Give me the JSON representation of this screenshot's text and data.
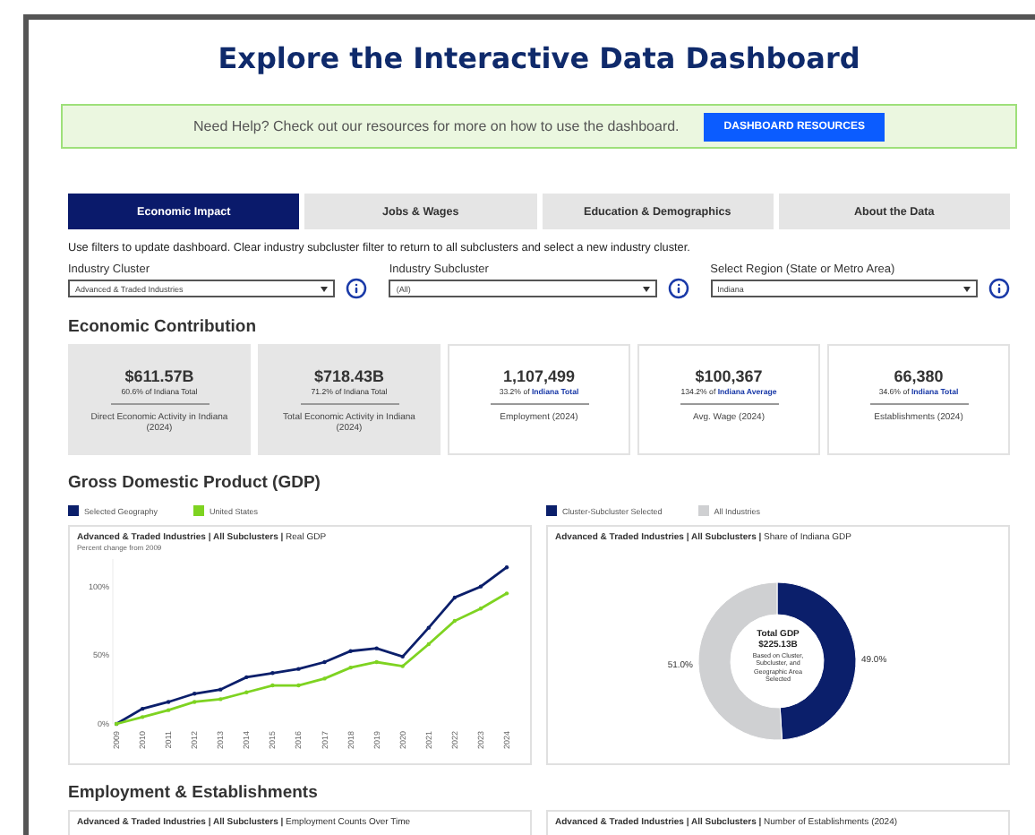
{
  "title": "Explore the Interactive Data Dashboard",
  "help_banner": {
    "text": "Need Help? Check out our resources for more on how to use the dashboard.",
    "button": "DASHBOARD RESOURCES"
  },
  "tabs": [
    {
      "label": "Economic Impact",
      "selected": true
    },
    {
      "label": "Jobs & Wages",
      "selected": false
    },
    {
      "label": "Education & Demographics",
      "selected": false
    },
    {
      "label": "About the Data",
      "selected": false
    }
  ],
  "instructions": "Use filters to update dashboard. Clear industry subcluster filter to return to all subclusters and select a new industry cluster.",
  "filters": [
    {
      "label": "Industry Cluster",
      "value": "Advanced & Traded Industries"
    },
    {
      "label": "Industry Subcluster",
      "value": "(All)"
    },
    {
      "label": "Select Region (State or Metro Area)",
      "value": "Indiana"
    }
  ],
  "economic_contribution": {
    "heading": "Economic Contribution",
    "cards": [
      {
        "value": "$611.57B",
        "note": "60.6% of Indiana Total",
        "label": "Direct Economic Activity in Indiana (2024)",
        "shaded": true
      },
      {
        "value": "$718.43B",
        "note": "71.2% of Indiana Total",
        "label": "Total Economic Activity in Indiana (2024)",
        "shaded": true
      },
      {
        "value": "1,107,499",
        "note": "33.2% of",
        "note_link": "Indiana Total",
        "label": "Employment (2024)",
        "shaded": false
      },
      {
        "value": "$100,367",
        "note": "134.2% of",
        "note_link": "Indiana Average",
        "label": "Avg. Wage (2024)",
        "shaded": false
      },
      {
        "value": "66,380",
        "note": "34.6% of",
        "note_link": "Indiana Total",
        "label": "Establishments (2024)",
        "shaded": false
      }
    ]
  },
  "gdp": {
    "heading": "Gross Domestic Product (GDP)",
    "line_panel": {
      "title": "**Advanced & Traded Industries | All Subclusters |** Real GDP",
      "subtitle": "Percent change from 2009",
      "chart_data": {
        "type": "line",
        "x": [
          "2009",
          "2010",
          "2011",
          "2012",
          "2013",
          "2014",
          "2015",
          "2016",
          "2017",
          "2018",
          "2019",
          "2020",
          "2021",
          "2022",
          "2023",
          "2024"
        ],
        "ylim": [
          0,
          120
        ],
        "yticks": [
          {
            "value": 0,
            "label": "0%"
          },
          {
            "value": 50,
            "label": "50%"
          },
          {
            "value": 100,
            "label": "100%"
          }
        ],
        "series": [
          {
            "name": "Selected Geography",
            "color": "#0b1f6b",
            "values": [
              0,
              11,
              16,
              22,
              25,
              34,
              37,
              40,
              45,
              53,
              55,
              49,
              70,
              92,
              100,
              114
            ]
          },
          {
            "name": "United States",
            "color": "#7ed321",
            "values": [
              0,
              5,
              10,
              16,
              18,
              23,
              28,
              28,
              33,
              41,
              45,
              42,
              58,
              75,
              84,
              95
            ]
          }
        ]
      }
    },
    "donut_panel": {
      "title": "**Advanced & Traded Industries | All Subclusters |** Share of Indiana GDP",
      "center_title": "Total GDP",
      "center_value": "$225.13B",
      "center_note": "Based on Cluster, Subcluster, and Geographic Area Selected",
      "chart_data": {
        "type": "donut",
        "categories": [
          "Cluster-Subcluster Selected",
          "All Industries"
        ],
        "values": [
          49.0,
          51.0
        ],
        "colors": [
          "#0b1f6b",
          "#cfd0d2"
        ],
        "value_labels": [
          "49.0%",
          "51.0%"
        ]
      }
    }
  },
  "employment": {
    "heading": "Employment & Establishments",
    "panels": [
      "**Advanced & Traded Industries | All Subclusters |** Employment Counts Over Time",
      "**Advanced & Traded Industries | All Subclusters |** Number of Establishments (2024)"
    ]
  }
}
